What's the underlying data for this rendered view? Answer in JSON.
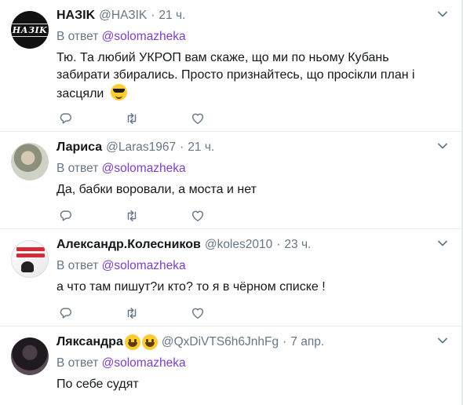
{
  "reply_prefix": "В ответ",
  "colors": {
    "mention": "#7b3fc4",
    "meta": "#657786",
    "text": "#14171a"
  },
  "tweets": [
    {
      "name": "НАЗIK",
      "handle": "@НАЗIK",
      "dot": "·",
      "time": "21 ч.",
      "avatar_text": "НАЗIK",
      "reply_to": "@solomazheka",
      "text": "Тю. Та любий УКРОП вам скаже, що ми по ньому Кубань забирати збирались. Просто признайтесь, що просікли план і засцяли",
      "emoji": "smiling-face-with-sunglasses"
    },
    {
      "name": "Лариса",
      "handle": "@Laras1967",
      "dot": "·",
      "time": "21 ч.",
      "reply_to": "@solomazheka",
      "text": "Да, бабки воровали, а моста и нет"
    },
    {
      "name": "Александр.Колесников",
      "handle": "@koles2010",
      "dot": "·",
      "time": "23 ч.",
      "reply_to": "@solomazheka",
      "text": "а что там пишут?и кто? то я в чёрном списке !"
    },
    {
      "name": "Ляксандра",
      "handle": "@QxDiVTS6h6JnhFg",
      "dot": "·",
      "time": "7 апр.",
      "name_emojis": [
        "grinning-face",
        "grinning-face"
      ],
      "reply_to": "@solomazheka",
      "text": "По себе судят"
    }
  ],
  "icons": {
    "reply": "reply-icon",
    "retweet": "retweet-icon",
    "like": "heart-icon",
    "more": "chevron-down-icon"
  }
}
